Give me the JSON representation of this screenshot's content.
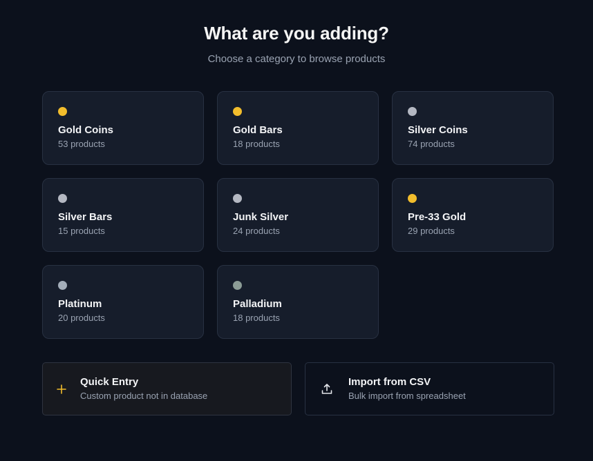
{
  "header": {
    "title": "What are you adding?",
    "subtitle": "Choose a category to browse products"
  },
  "categories": [
    {
      "name": "Gold Coins",
      "count": "53 products",
      "color": "#f2bd2c"
    },
    {
      "name": "Gold Bars",
      "count": "18 products",
      "color": "#f2bd2c"
    },
    {
      "name": "Silver Coins",
      "count": "74 products",
      "color": "#b4b8c2"
    },
    {
      "name": "Silver Bars",
      "count": "15 products",
      "color": "#b4b8c2"
    },
    {
      "name": "Junk Silver",
      "count": "24 products",
      "color": "#b4b8c2"
    },
    {
      "name": "Pre-33 Gold",
      "count": "29 products",
      "color": "#f2bd2c"
    },
    {
      "name": "Platinum",
      "count": "20 products",
      "color": "#a3adb9"
    },
    {
      "name": "Palladium",
      "count": "18 products",
      "color": "#8c9c96"
    }
  ],
  "actions": {
    "quick": {
      "title": "Quick Entry",
      "subtitle": "Custom product not in database",
      "icon": "plus-icon",
      "icon_color": "#f2bd2c"
    },
    "csv": {
      "title": "Import from CSV",
      "subtitle": "Bulk import from spreadsheet",
      "icon": "upload-icon",
      "icon_color": "#e5e7eb"
    }
  }
}
